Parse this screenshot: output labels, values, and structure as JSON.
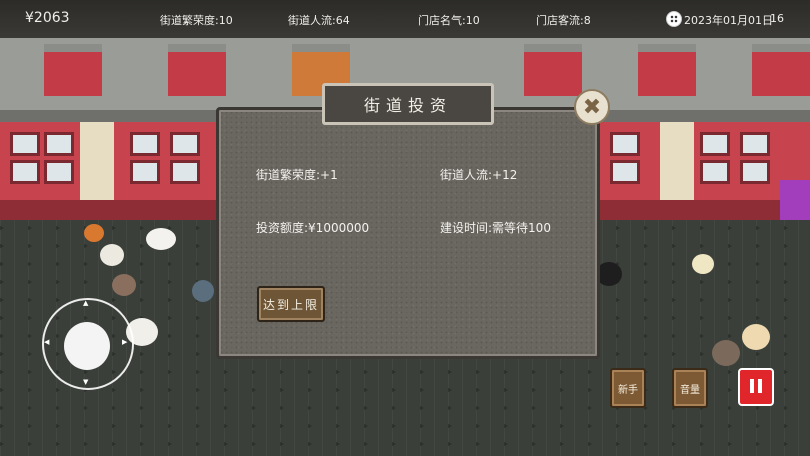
{
  "hud": {
    "money": "¥2063",
    "street_prosperity": "街道繁荣度:10",
    "street_traffic": "街道人流:64",
    "store_popularity": "门店名气:10",
    "store_customers": "门店客流:8",
    "date": "2023年01月01日",
    "day": "16"
  },
  "modal": {
    "title": "街道投资",
    "close_label": "✖",
    "prosperity_gain": "街道繁荣度:+1",
    "traffic_gain": "街道人流:+12",
    "investment_amount": "投资额度:¥1000000",
    "build_time": "建设时间:需等待100",
    "limit_button": "达到上限"
  },
  "controls": {
    "guide_button": "新手",
    "volume_button": "音量"
  },
  "colors": {
    "accent_red": "#e0262a",
    "button_brown": "#7d5a33",
    "modal_bg": "#6a6660"
  }
}
